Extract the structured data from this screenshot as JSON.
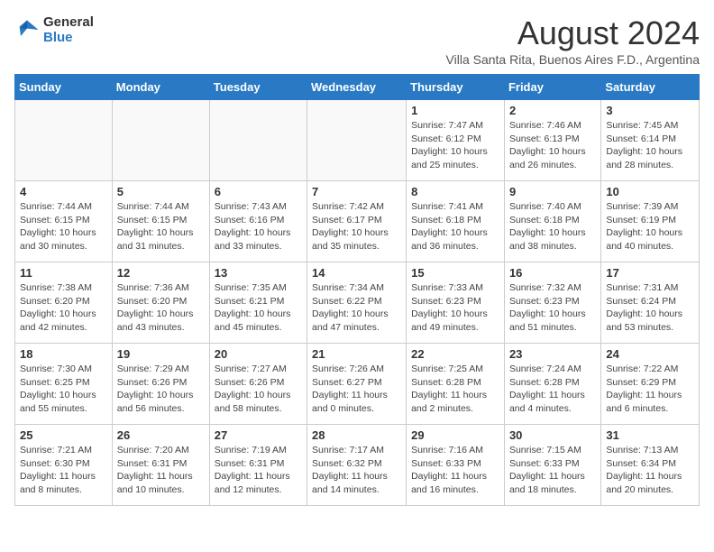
{
  "header": {
    "logo_line1": "General",
    "logo_line2": "Blue",
    "month_title": "August 2024",
    "subtitle": "Villa Santa Rita, Buenos Aires F.D., Argentina"
  },
  "days_of_week": [
    "Sunday",
    "Monday",
    "Tuesday",
    "Wednesday",
    "Thursday",
    "Friday",
    "Saturday"
  ],
  "weeks": [
    [
      {
        "day": "",
        "info": ""
      },
      {
        "day": "",
        "info": ""
      },
      {
        "day": "",
        "info": ""
      },
      {
        "day": "",
        "info": ""
      },
      {
        "day": "1",
        "info": "Sunrise: 7:47 AM\nSunset: 6:12 PM\nDaylight: 10 hours and 25 minutes."
      },
      {
        "day": "2",
        "info": "Sunrise: 7:46 AM\nSunset: 6:13 PM\nDaylight: 10 hours and 26 minutes."
      },
      {
        "day": "3",
        "info": "Sunrise: 7:45 AM\nSunset: 6:14 PM\nDaylight: 10 hours and 28 minutes."
      }
    ],
    [
      {
        "day": "4",
        "info": "Sunrise: 7:44 AM\nSunset: 6:15 PM\nDaylight: 10 hours and 30 minutes."
      },
      {
        "day": "5",
        "info": "Sunrise: 7:44 AM\nSunset: 6:15 PM\nDaylight: 10 hours and 31 minutes."
      },
      {
        "day": "6",
        "info": "Sunrise: 7:43 AM\nSunset: 6:16 PM\nDaylight: 10 hours and 33 minutes."
      },
      {
        "day": "7",
        "info": "Sunrise: 7:42 AM\nSunset: 6:17 PM\nDaylight: 10 hours and 35 minutes."
      },
      {
        "day": "8",
        "info": "Sunrise: 7:41 AM\nSunset: 6:18 PM\nDaylight: 10 hours and 36 minutes."
      },
      {
        "day": "9",
        "info": "Sunrise: 7:40 AM\nSunset: 6:18 PM\nDaylight: 10 hours and 38 minutes."
      },
      {
        "day": "10",
        "info": "Sunrise: 7:39 AM\nSunset: 6:19 PM\nDaylight: 10 hours and 40 minutes."
      }
    ],
    [
      {
        "day": "11",
        "info": "Sunrise: 7:38 AM\nSunset: 6:20 PM\nDaylight: 10 hours and 42 minutes."
      },
      {
        "day": "12",
        "info": "Sunrise: 7:36 AM\nSunset: 6:20 PM\nDaylight: 10 hours and 43 minutes."
      },
      {
        "day": "13",
        "info": "Sunrise: 7:35 AM\nSunset: 6:21 PM\nDaylight: 10 hours and 45 minutes."
      },
      {
        "day": "14",
        "info": "Sunrise: 7:34 AM\nSunset: 6:22 PM\nDaylight: 10 hours and 47 minutes."
      },
      {
        "day": "15",
        "info": "Sunrise: 7:33 AM\nSunset: 6:23 PM\nDaylight: 10 hours and 49 minutes."
      },
      {
        "day": "16",
        "info": "Sunrise: 7:32 AM\nSunset: 6:23 PM\nDaylight: 10 hours and 51 minutes."
      },
      {
        "day": "17",
        "info": "Sunrise: 7:31 AM\nSunset: 6:24 PM\nDaylight: 10 hours and 53 minutes."
      }
    ],
    [
      {
        "day": "18",
        "info": "Sunrise: 7:30 AM\nSunset: 6:25 PM\nDaylight: 10 hours and 55 minutes."
      },
      {
        "day": "19",
        "info": "Sunrise: 7:29 AM\nSunset: 6:26 PM\nDaylight: 10 hours and 56 minutes."
      },
      {
        "day": "20",
        "info": "Sunrise: 7:27 AM\nSunset: 6:26 PM\nDaylight: 10 hours and 58 minutes."
      },
      {
        "day": "21",
        "info": "Sunrise: 7:26 AM\nSunset: 6:27 PM\nDaylight: 11 hours and 0 minutes."
      },
      {
        "day": "22",
        "info": "Sunrise: 7:25 AM\nSunset: 6:28 PM\nDaylight: 11 hours and 2 minutes."
      },
      {
        "day": "23",
        "info": "Sunrise: 7:24 AM\nSunset: 6:28 PM\nDaylight: 11 hours and 4 minutes."
      },
      {
        "day": "24",
        "info": "Sunrise: 7:22 AM\nSunset: 6:29 PM\nDaylight: 11 hours and 6 minutes."
      }
    ],
    [
      {
        "day": "25",
        "info": "Sunrise: 7:21 AM\nSunset: 6:30 PM\nDaylight: 11 hours and 8 minutes."
      },
      {
        "day": "26",
        "info": "Sunrise: 7:20 AM\nSunset: 6:31 PM\nDaylight: 11 hours and 10 minutes."
      },
      {
        "day": "27",
        "info": "Sunrise: 7:19 AM\nSunset: 6:31 PM\nDaylight: 11 hours and 12 minutes."
      },
      {
        "day": "28",
        "info": "Sunrise: 7:17 AM\nSunset: 6:32 PM\nDaylight: 11 hours and 14 minutes."
      },
      {
        "day": "29",
        "info": "Sunrise: 7:16 AM\nSunset: 6:33 PM\nDaylight: 11 hours and 16 minutes."
      },
      {
        "day": "30",
        "info": "Sunrise: 7:15 AM\nSunset: 6:33 PM\nDaylight: 11 hours and 18 minutes."
      },
      {
        "day": "31",
        "info": "Sunrise: 7:13 AM\nSunset: 6:34 PM\nDaylight: 11 hours and 20 minutes."
      }
    ]
  ]
}
